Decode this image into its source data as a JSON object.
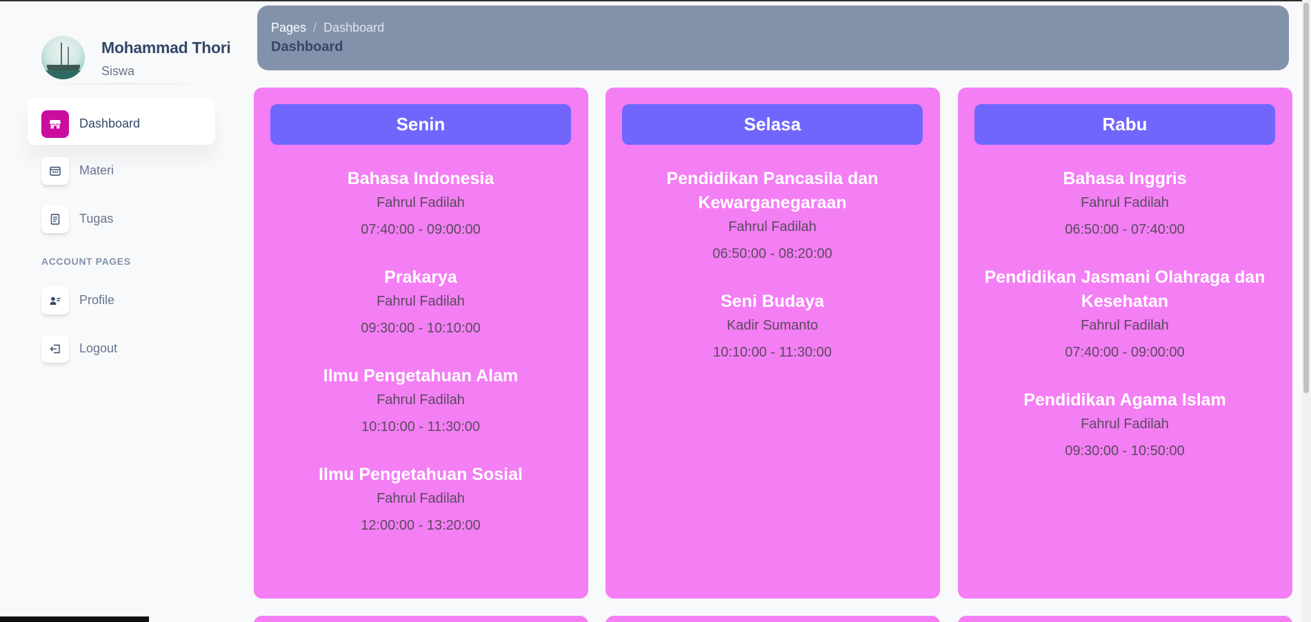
{
  "user": {
    "name": "Mohammad Thori",
    "role": "Siswa"
  },
  "nav": {
    "items": [
      {
        "label": "Dashboard",
        "icon": "shop-icon",
        "active": true
      },
      {
        "label": "Materi",
        "icon": "calendar-icon",
        "active": false
      },
      {
        "label": "Tugas",
        "icon": "document-icon",
        "active": false
      }
    ],
    "section_title": "ACCOUNT PAGES",
    "account_items": [
      {
        "label": "Profile",
        "icon": "user-icon"
      },
      {
        "label": "Logout",
        "icon": "logout-icon"
      }
    ]
  },
  "breadcrumb": {
    "root": "Pages",
    "separator": "/",
    "current": "Dashboard",
    "title": "Dashboard"
  },
  "days": [
    {
      "name": "Senin",
      "lessons": [
        {
          "subject": "Bahasa Indonesia",
          "teacher": "Fahrul Fadilah",
          "time": "07:40:00 - 09:00:00"
        },
        {
          "subject": "Prakarya",
          "teacher": "Fahrul Fadilah",
          "time": "09:30:00 - 10:10:00"
        },
        {
          "subject": "Ilmu Pengetahuan Alam",
          "teacher": "Fahrul Fadilah",
          "time": "10:10:00 - 11:30:00"
        },
        {
          "subject": "Ilmu Pengetahuan Sosial",
          "teacher": "Fahrul Fadilah",
          "time": "12:00:00 - 13:20:00"
        }
      ]
    },
    {
      "name": "Selasa",
      "lessons": [
        {
          "subject": "Pendidikan Pancasila dan Kewarganegaraan",
          "teacher": "Fahrul Fadilah",
          "time": "06:50:00 - 08:20:00"
        },
        {
          "subject": "Seni Budaya",
          "teacher": "Kadir Sumanto",
          "time": "10:10:00 - 11:30:00"
        }
      ]
    },
    {
      "name": "Rabu",
      "lessons": [
        {
          "subject": "Bahasa Inggris",
          "teacher": "Fahrul Fadilah",
          "time": "06:50:00 - 07:40:00"
        },
        {
          "subject": "Pendidikan Jasmani Olahraga dan Kesehatan",
          "teacher": "Fahrul Fadilah",
          "time": "07:40:00 - 09:00:00"
        },
        {
          "subject": "Pendidikan Agama Islam",
          "teacher": "Fahrul Fadilah",
          "time": "09:30:00 - 10:50:00"
        }
      ]
    }
  ],
  "colors": {
    "card_bg": "#f47ef4",
    "day_header_bg": "#7066fb",
    "breadcrumb_bg": "#8392ab",
    "active_icon_bg": "#cb0c9f"
  }
}
